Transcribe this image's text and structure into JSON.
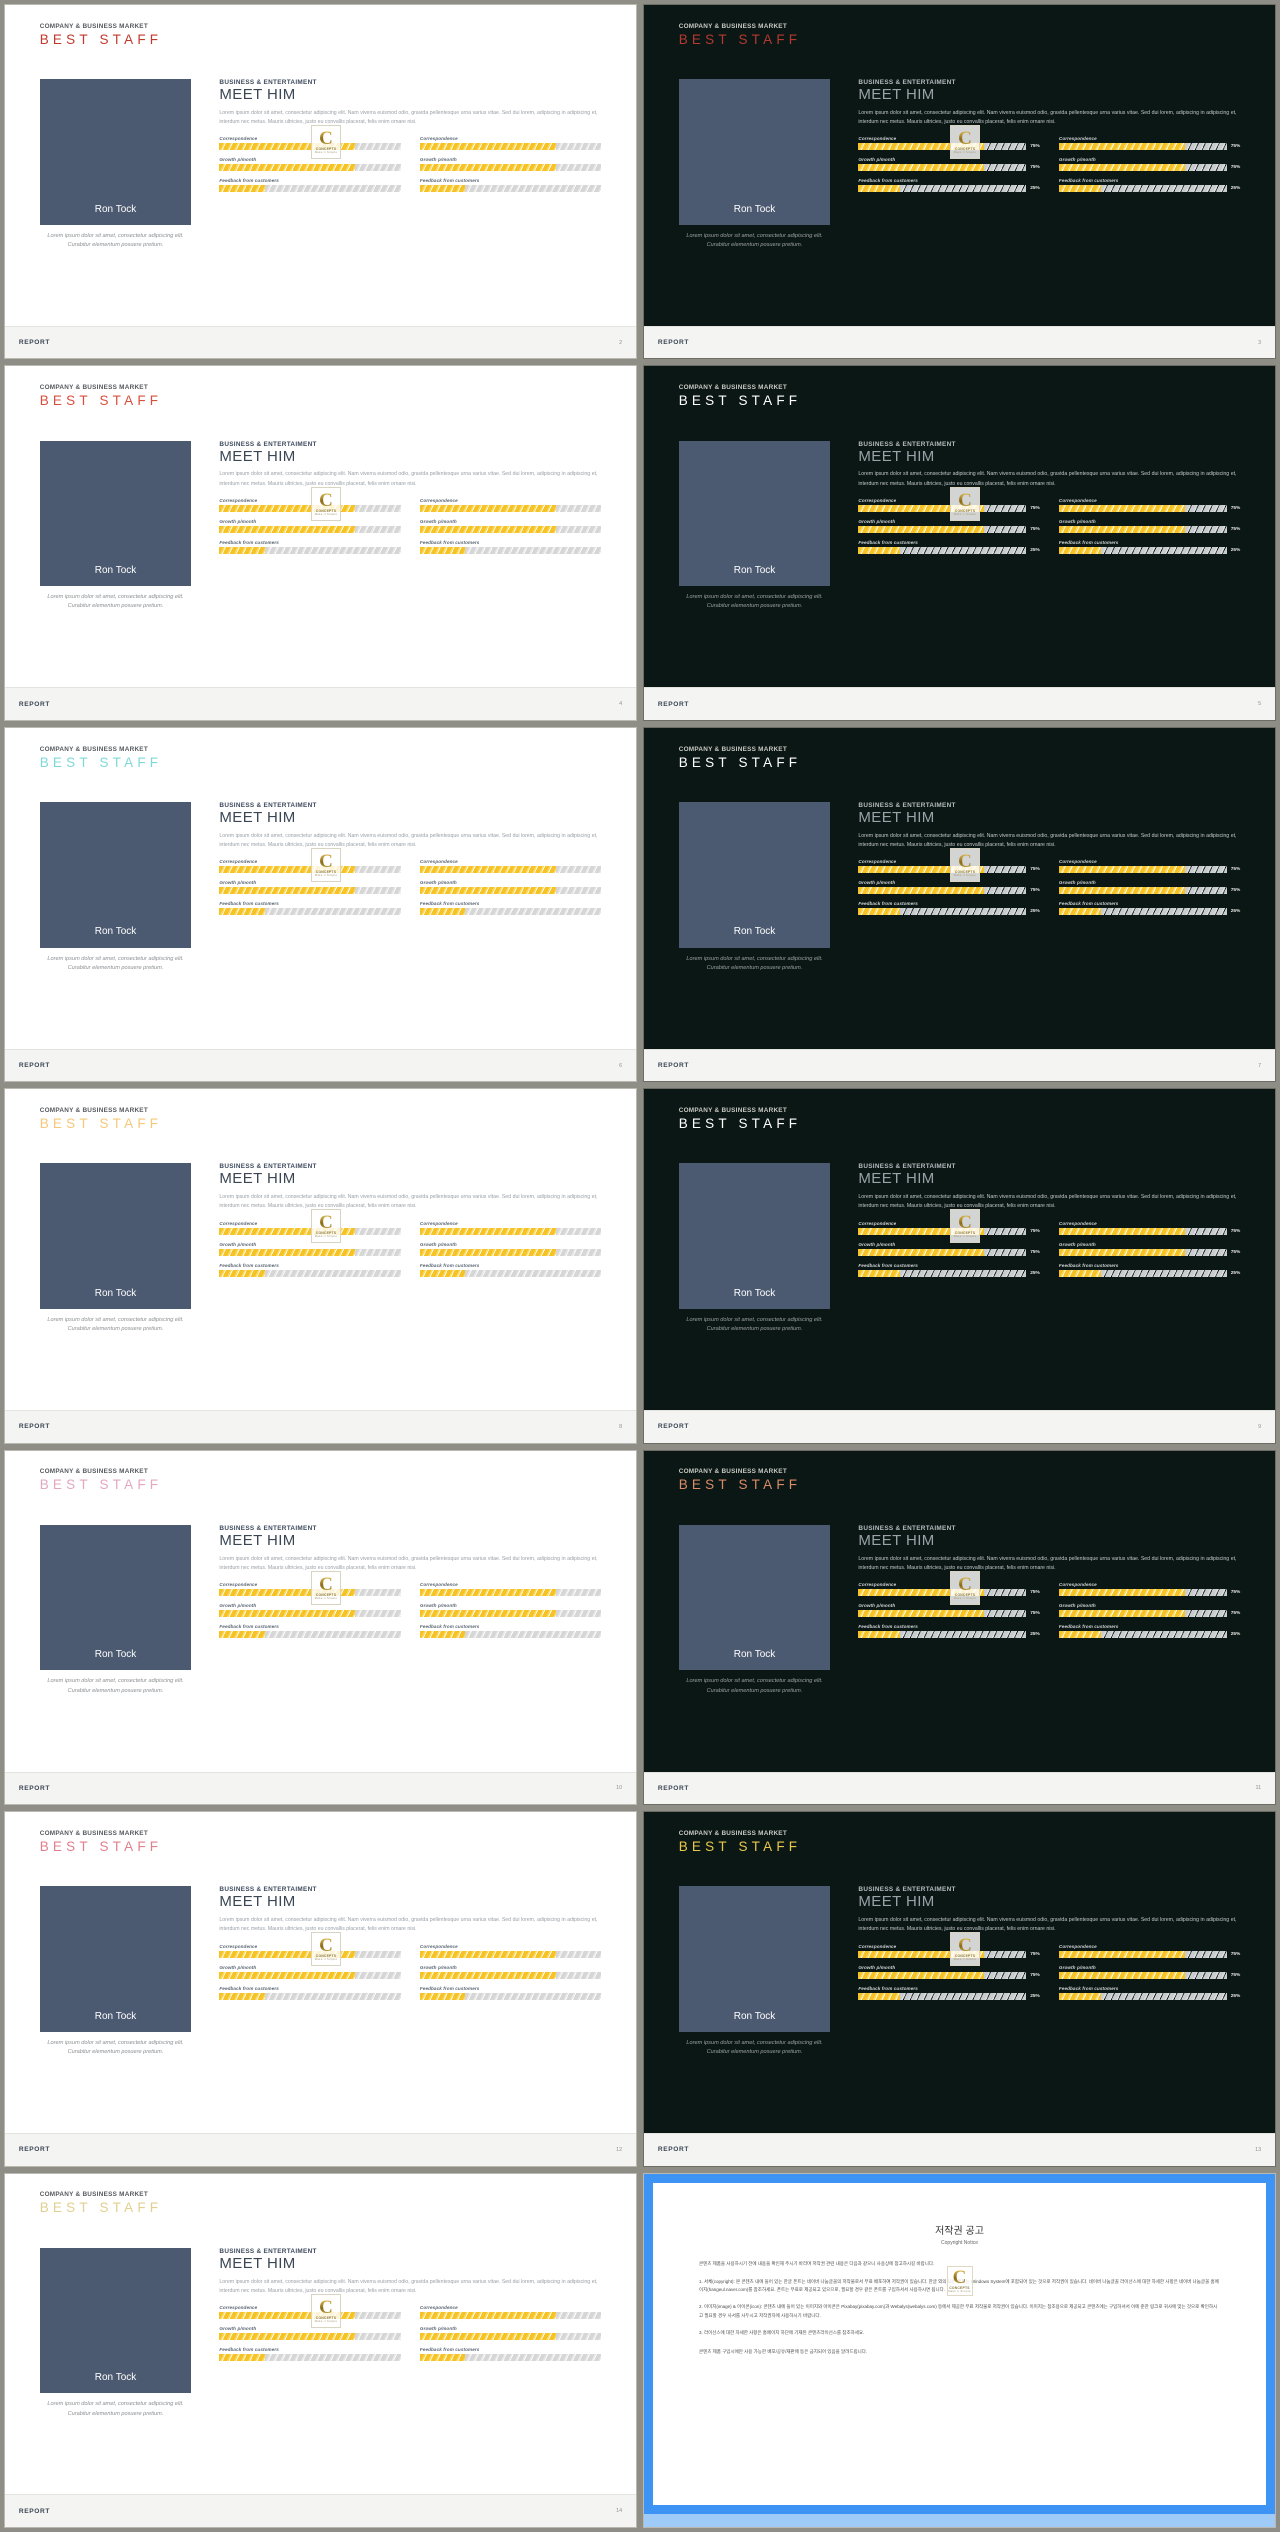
{
  "deck": {
    "kicker": "COMPANY & BUSINESS MARKET",
    "title": "BEST STAFF",
    "section_kicker": "BUSINESS & ENTERTAIMENT",
    "section_title": "MEET HIM",
    "paragraph": "Lorem ipsum dolor sit amet, consectetur adipiscing elit. Nam viverra euismod odio, gravida pellentesque urna varius vitae. Sed dui lorem, adipiscing in adipiscing et, interdum nec metus. Mauris ultricies, justo eu convallis placerat, felis enim ornare nisi.",
    "photo_name": "Ron Tock",
    "photo_caption": "Lorem ipsum dolor sit amet, consectetur adipiscing elit. Curabitur elementum posuere pretium.",
    "footer_label": "REPORT",
    "watermark": {
      "letter": "C",
      "brand": "CONCEPTS",
      "sub": "Make it Simple"
    }
  },
  "stats": {
    "left": [
      {
        "label": "Correspondence",
        "value": 75
      },
      {
        "label": "Growth p/month",
        "value": 75
      },
      {
        "label": "Feedback from customers",
        "value": 25
      }
    ],
    "right": [
      {
        "label": "Correspondence",
        "value": 75
      },
      {
        "label": "Growth p/month",
        "value": 75
      },
      {
        "label": "Feedback from customers",
        "value": 25
      }
    ]
  },
  "percent_labels": {
    "p75": "75%",
    "p25": "25%"
  },
  "slides": [
    {
      "n": 1,
      "page": "2",
      "theme": "light",
      "accent": "#c0392b"
    },
    {
      "n": 2,
      "page": "3",
      "theme": "dark",
      "accent": "#b4392f"
    },
    {
      "n": 3,
      "page": "4",
      "theme": "light",
      "accent": "#d94f3d"
    },
    {
      "n": 4,
      "page": "5",
      "theme": "dark",
      "accent": "#ffffff"
    },
    {
      "n": 5,
      "page": "6",
      "theme": "light",
      "accent": "#7fd8d8"
    },
    {
      "n": 6,
      "page": "7",
      "theme": "dark",
      "accent": "#ffffff"
    },
    {
      "n": 7,
      "page": "8",
      "theme": "light",
      "accent": "#f5c87a"
    },
    {
      "n": 8,
      "page": "9",
      "theme": "dark",
      "accent": "#ffffff"
    },
    {
      "n": 9,
      "page": "10",
      "theme": "light",
      "accent": "#e3a7c0"
    },
    {
      "n": 10,
      "page": "11",
      "theme": "dark",
      "accent": "#d98b6a"
    },
    {
      "n": 11,
      "page": "12",
      "theme": "light",
      "accent": "#e0808c"
    },
    {
      "n": 12,
      "page": "13",
      "theme": "dark",
      "accent": "#e8c84a"
    },
    {
      "n": 13,
      "page": "14",
      "theme": "light",
      "accent": "#e2cf8e"
    }
  ],
  "copyright": {
    "title": "저작권 공고",
    "subtitle": "Copyright Notice",
    "intro": "콘텐츠 제품을 사용하시기 전에 내용을 확인해 주시기 바라며 저작권 관련 내용은 다음과 같으니 사용상에 참고하시길 바랍니다.",
    "items": [
      "1. 서체(copyright): 본 콘텐츠 내에 들어 있는 한글 폰트는 네이버 나눔글꼴의 저작물로서 무료 배포하여 저작권이 있습니다. 한글 외의 모든 폰트는 Windows System에 포함되어 있는 것으로 저작권이 있습니다. 네이버 나눔글꼴 라이선스에 대한 자세한 사항은 네이버 나눔글꼴 홈페이지(hangeul.naver.com)를 참조하세요. 폰트는 무료로 제공되고 있으므로, 필요할 경우 같은 폰트를 구입하셔서 사용하시면 됩니다.",
      "2. 이미지(image) & 아이콘(icon): 콘텐츠 내에 들어 있는 이미지와 아이콘은 Pixabay(pixabay.com)과 Webalys(webalys.com) 등에서 제공한 무료 저작물로 저작권이 있습니다. 이미지는 참조용으로 제공되고 콘텐츠에는 구입하셔서 이에 준한 링크로 귀사에 맞는 것으로 확인하시고 필요할 경우 사서를 사두시고 저작권자에 사용하시기 바랍니다.",
      "3. 라이선스에 대한 자세한 사항은 홈페이지 하단에 기재된 콘텐츠라이선스를 참조하세요."
    ],
    "outro": "콘텐츠 제품 구입시에만 사용 가능한 배포/공유/재판매 등은 금지되어 있음을 알려드립니다."
  }
}
